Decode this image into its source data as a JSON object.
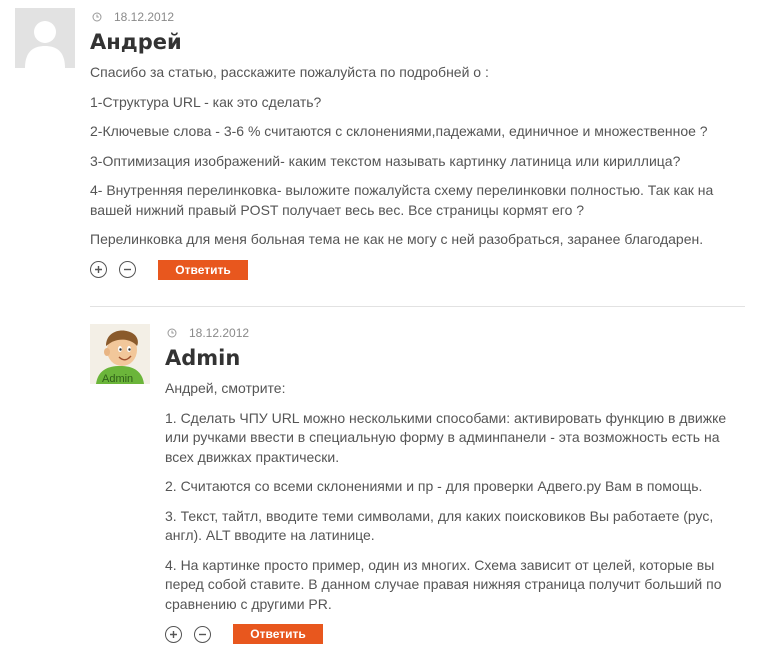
{
  "comments": [
    {
      "date": "18.12.2012",
      "author": "Андрей",
      "paragraphs": [
        "Спасибо за статью, расскажите пожалуйста по подробней о :",
        "1-Структура URL - как это сделать?",
        "2-Ключевые слова - 3-6 % считаются с склонениями,падежами, единичное и множественное ?",
        "3-Оптимизация изображений- каким текстом называть картинку латиница или кириллица?",
        "4- Внутренняя перелинковка- выложите пожалуйста схему перелинковки полностью. Так как на вашей нижний правый POST получает весь вес. Все страницы кормят его ?",
        "Перелинковка для меня больная тема не как не могу с ней разобраться, заранее благодарен."
      ],
      "reply_label": "Ответить"
    },
    {
      "date": "18.12.2012",
      "author": "Admin",
      "avatar_caption": "Admin",
      "paragraphs": [
        "Андрей, смотрите:",
        "1. Сделать ЧПУ URL можно несколькими способами: активировать функцию в движке или ручками ввести в специальную форму в админпанели - эта возможность есть на всех движках практически.",
        "2. Считаются со всеми склонениями и пр - для проверки Адвего.ру Вам в помощь.",
        "3. Текст, тайтл, вводите теми символами, для каких поисковиков Вы работаете (рус, англ). ALT вводите на латинице.",
        "4. На картинке просто пример, один из многих. Схема зависит от целей, которые вы перед собой ставите. В данном случае правая нижняя страница получит больший по сравнению с другими PR."
      ],
      "reply_label": "Ответить"
    }
  ],
  "icons": {
    "date": "clock-icon",
    "vote_up": "plus-icon",
    "vote_down": "minus-icon",
    "avatar_default": "user-silhouette-icon"
  },
  "colors": {
    "reply_button": "#e8571e",
    "author_text": "#333333",
    "body_text": "#555555",
    "meta_text": "#8a8a8a"
  }
}
